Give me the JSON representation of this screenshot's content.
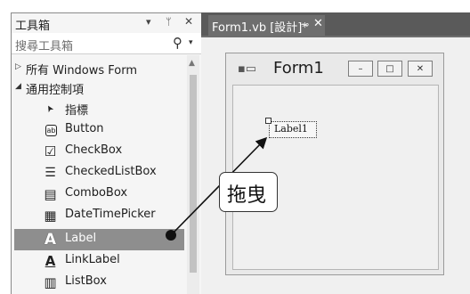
{
  "toolbox": {
    "title": "工具箱",
    "ctrl_dropdown": "▾",
    "ctrl_pin": "ᛘ",
    "ctrl_close": "✕",
    "search_placeholder": "搜尋工具箱",
    "search_icon": "search-icon",
    "groups": [
      {
        "label": "所有 Windows Form",
        "expanded": false
      },
      {
        "label": "通用控制項",
        "expanded": true
      }
    ],
    "items": [
      {
        "label": "指標",
        "icon": "pointer-icon",
        "glyph": "➤"
      },
      {
        "label": "Button",
        "icon": "button-icon",
        "glyph": "ab"
      },
      {
        "label": "CheckBox",
        "icon": "checkbox-icon",
        "glyph": "☑"
      },
      {
        "label": "CheckedListBox",
        "icon": "checked-list-icon",
        "glyph": "☰"
      },
      {
        "label": "ComboBox",
        "icon": "combobox-icon",
        "glyph": "▤"
      },
      {
        "label": "DateTimePicker",
        "icon": "calendar-icon",
        "glyph": "▦"
      },
      {
        "label": "Label",
        "icon": "label-icon",
        "glyph": "A",
        "selected": true
      },
      {
        "label": "LinkLabel",
        "icon": "link-label-icon",
        "glyph": "A"
      },
      {
        "label": "ListBox",
        "icon": "listbox-icon",
        "glyph": "▥"
      }
    ]
  },
  "document_tab": {
    "label": "Form1.vb [設計]*",
    "pin": "⊸",
    "close": "✕"
  },
  "form": {
    "title": "Form1",
    "minimize": "–",
    "maximize": "□",
    "close": "✕",
    "label_control_text": "Label1"
  },
  "callout": {
    "text": "拖曳"
  },
  "colors": {
    "selection": "#8e8e8e",
    "tab_strip": "#5a5a5a",
    "panel": "#f5f5f5"
  }
}
